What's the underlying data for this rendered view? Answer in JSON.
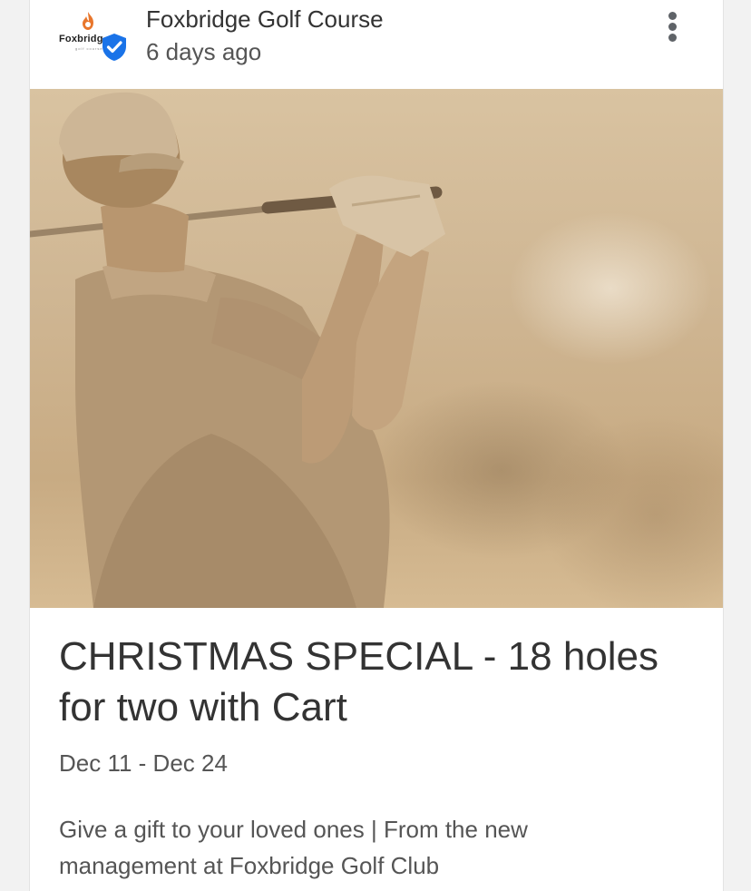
{
  "post": {
    "page_name": "Foxbridge Golf Course",
    "timestamp": "6 days ago",
    "avatar": {
      "logo_text": "Foxbridg",
      "logo_subtext": "golf course",
      "verified_icon": "verified-badge-icon"
    },
    "menu_icon": "more-vert-icon",
    "image": {
      "subject": "golfer-photo",
      "tone": "sepia"
    },
    "title": "CHRISTMAS SPECIAL - 18 holes for two with Cart",
    "dates": "Dec 11 - Dec 24",
    "description": "Give a gift to your loved ones | From the new management at Foxbridge Golf Club"
  },
  "colors": {
    "background": "#f2f2f2",
    "card": "#ffffff",
    "text_primary": "#333333",
    "text_secondary": "#555555",
    "verified": "#1a73e8",
    "logo_accent": "#e8762c",
    "photo_sepia": "#cfb693"
  }
}
